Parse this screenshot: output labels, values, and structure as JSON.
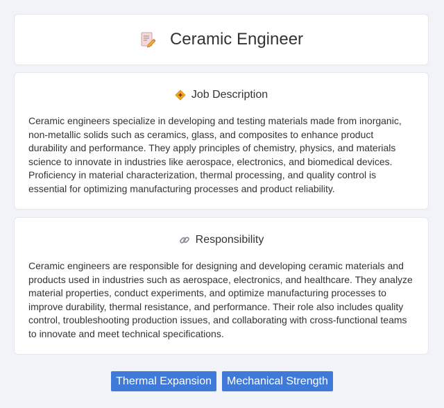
{
  "header": {
    "title": "Ceramic Engineer",
    "icon": "document-pencil-icon"
  },
  "job_description": {
    "heading": "Job Description",
    "icon": "diamond-sparkle-icon",
    "text": "Ceramic engineers specialize in developing and testing materials made from inorganic, non-metallic solids such as ceramics, glass, and composites to enhance product durability and performance. They apply principles of chemistry, physics, and materials science to innovate in industries like aerospace, electronics, and biomedical devices. Proficiency in material characterization, thermal processing, and quality control is essential for optimizing manufacturing processes and product reliability."
  },
  "responsibility": {
    "heading": "Responsibility",
    "icon": "link-icon",
    "text": "Ceramic engineers are responsible for designing and developing ceramic materials and products used in industries such as aerospace, electronics, and healthcare. They analyze material properties, conduct experiments, and optimize manufacturing processes to improve durability, thermal resistance, and performance. Their role also includes quality control, troubleshooting production issues, and collaborating with cross-functional teams to innovate and meet technical specifications."
  },
  "tags": [
    {
      "label": "Thermal Expansion"
    },
    {
      "label": "Mechanical Strength"
    }
  ],
  "colors": {
    "background": "#f1f3f8",
    "card": "#ffffff",
    "tag": "#3f7ad8"
  }
}
